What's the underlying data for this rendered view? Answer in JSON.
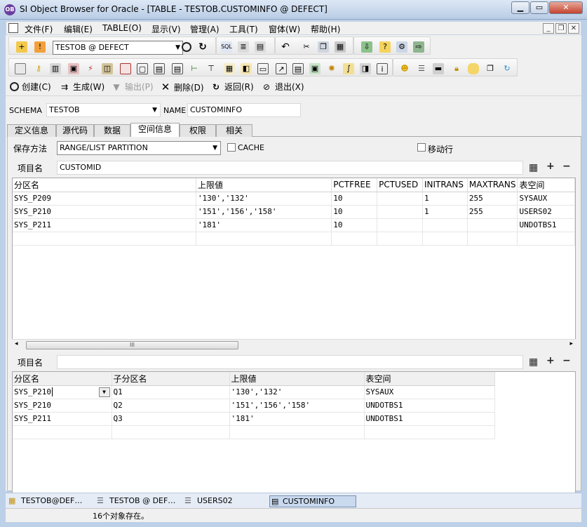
{
  "window": {
    "title": "SI Object Browser for Oracle - [TABLE - TESTOB.CUSTOMINFO @ DEFECT]",
    "app_icon": "OB"
  },
  "menu": [
    "文件(F)",
    "编辑(E)",
    "TABLE(O)",
    "显示(V)",
    "管理(A)",
    "工具(T)",
    "窗体(W)",
    "帮助(H)"
  ],
  "toolbar": {
    "connection": "TESTOB @ DEFECT"
  },
  "actions": {
    "create": "创建(C)",
    "generate": "生成(W)",
    "export": "输出(P)",
    "delete": "删除(D)",
    "back": "返回(R)",
    "exit": "退出(X)"
  },
  "form": {
    "schema_label": "SCHEMA",
    "schema_value": "TESTOB",
    "name_label": "NAME",
    "name_value": "CUSTOMINFO"
  },
  "tabs": [
    "定义信息",
    "源代码",
    "数据",
    "空间信息",
    "权限",
    "相关"
  ],
  "partition": {
    "storage_label": "保存方法",
    "storage_value": "RANGE/LIST PARTITION",
    "cache_label": "CACHE",
    "move_row_label": "移动行",
    "item_label": "项目名",
    "item_value": "CUSTOMID",
    "columns": [
      "分区名",
      "上限値",
      "PCTFREE",
      "PCTUSED",
      "INITRANS",
      "MAXTRANS",
      "表空间"
    ],
    "rows": [
      [
        "SYS_P209",
        "'130','132'",
        "10",
        "",
        "1",
        "255",
        "SYSAUX"
      ],
      [
        "SYS_P210",
        "'151','156','158'",
        "10",
        "",
        "1",
        "255",
        "USERS02"
      ],
      [
        "SYS_P211",
        "'181'",
        "10",
        "",
        "",
        "",
        "UNDOTBS1"
      ],
      [
        "",
        "",
        "",
        "",
        "",
        "",
        ""
      ]
    ],
    "scroll_grip": "III"
  },
  "subpartition": {
    "item_label": "项目名",
    "item_value": "",
    "columns": [
      "分区名",
      "子分区名",
      "上限値",
      "表空间"
    ],
    "rows": [
      [
        "SYS_P210",
        "Q1",
        "'130','132'",
        "SYSAUX"
      ],
      [
        "SYS_P210",
        "Q2",
        "'151','156','158'",
        "UNDOTBS1"
      ],
      [
        "SYS_P211",
        "Q3",
        "'181'",
        "UNDOTBS1"
      ],
      [
        "",
        "",
        "",
        ""
      ]
    ]
  },
  "taskbar": [
    "TESTOB@DEF…",
    "TESTOB @ DEF…",
    "USERS02",
    "CUSTOMINFO"
  ],
  "status": "16个对象存在。"
}
